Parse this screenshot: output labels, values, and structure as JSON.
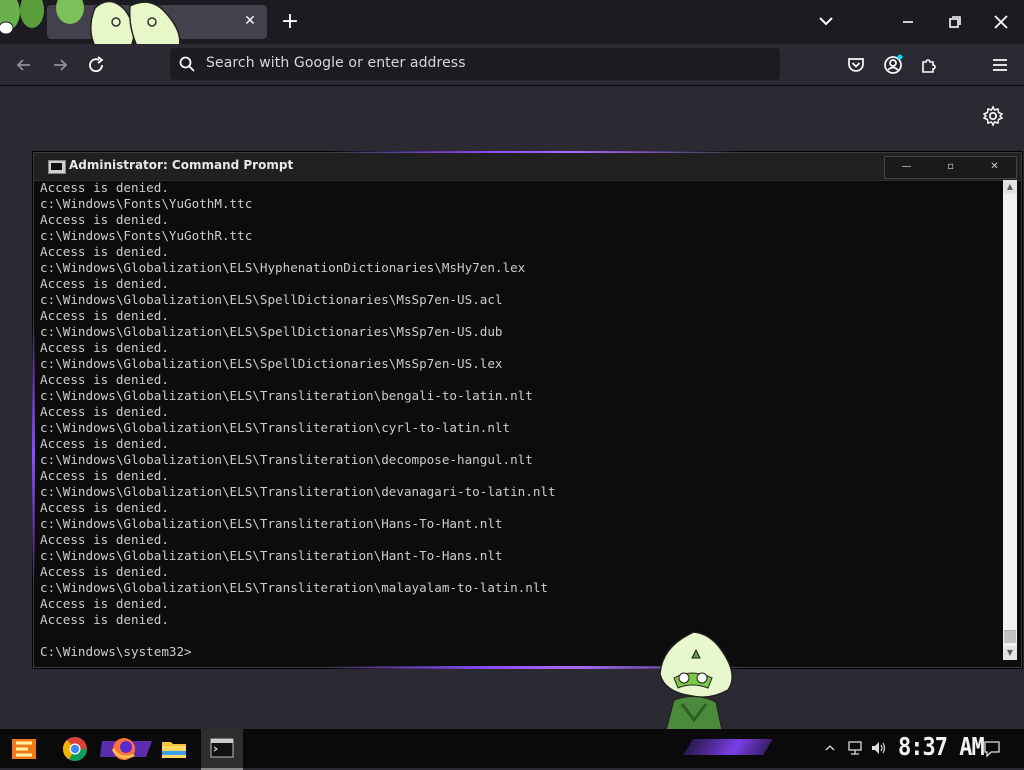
{
  "browser": {
    "tab_close": "✕",
    "new_tab": "+",
    "urlbar_placeholder": "Search with Google or enter address"
  },
  "cmd": {
    "title": "Administrator: Command Prompt",
    "minimize": "—",
    "restore": "▫",
    "close": "✕",
    "lines": [
      "Access is denied.",
      "c:\\Windows\\Fonts\\YuGothM.ttc",
      "Access is denied.",
      "c:\\Windows\\Fonts\\YuGothR.ttc",
      "Access is denied.",
      "c:\\Windows\\Globalization\\ELS\\HyphenationDictionaries\\MsHy7en.lex",
      "Access is denied.",
      "c:\\Windows\\Globalization\\ELS\\SpellDictionaries\\MsSp7en-US.acl",
      "Access is denied.",
      "c:\\Windows\\Globalization\\ELS\\SpellDictionaries\\MsSp7en-US.dub",
      "Access is denied.",
      "c:\\Windows\\Globalization\\ELS\\SpellDictionaries\\MsSp7en-US.lex",
      "Access is denied.",
      "c:\\Windows\\Globalization\\ELS\\Transliteration\\bengali-to-latin.nlt",
      "Access is denied.",
      "c:\\Windows\\Globalization\\ELS\\Transliteration\\cyrl-to-latin.nlt",
      "Access is denied.",
      "c:\\Windows\\Globalization\\ELS\\Transliteration\\decompose-hangul.nlt",
      "Access is denied.",
      "c:\\Windows\\Globalization\\ELS\\Transliteration\\devanagari-to-latin.nlt",
      "Access is denied.",
      "c:\\Windows\\Globalization\\ELS\\Transliteration\\Hans-To-Hant.nlt",
      "Access is denied.",
      "c:\\Windows\\Globalization\\ELS\\Transliteration\\Hant-To-Hans.nlt",
      "Access is denied.",
      "c:\\Windows\\Globalization\\ELS\\Transliteration\\malayalam-to-latin.nlt",
      "Access is denied.",
      "Access is denied.",
      "",
      "C:\\Windows\\system32>"
    ]
  },
  "taskbar": {
    "clock": "8:37 AM",
    "items": [
      "app-launcher-icon",
      "chrome-icon",
      "firefox-icon",
      "file-explorer-icon",
      "command-prompt-icon"
    ]
  },
  "colors": {
    "accent_purple": "#8b4dff",
    "terminal_bg": "#0c0c0c",
    "terminal_text": "#cccccc",
    "sticker_green": "#c9f0a6"
  }
}
